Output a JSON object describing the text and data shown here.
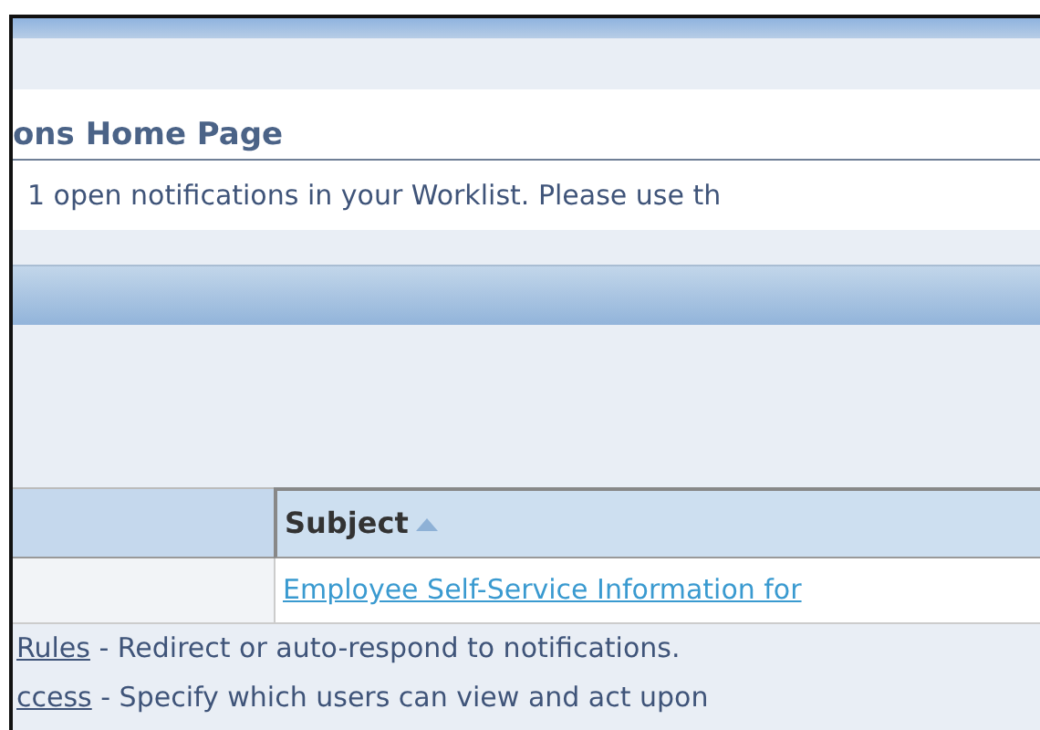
{
  "page_title": "ons Home Page",
  "message": "1 open notifications in your Worklist. Please use th",
  "table": {
    "columns": [
      {
        "sorted_ascending": false
      },
      {
        "label": "Subject",
        "sorted_ascending": true
      }
    ],
    "rows": [
      {
        "subject": "Employee Self-Service Information for"
      }
    ]
  },
  "links": [
    {
      "link": "Rules",
      "text": "- Redirect or auto-respond to notifications."
    },
    {
      "link": "ccess",
      "text": "- Specify which users can view and act upon"
    }
  ]
}
